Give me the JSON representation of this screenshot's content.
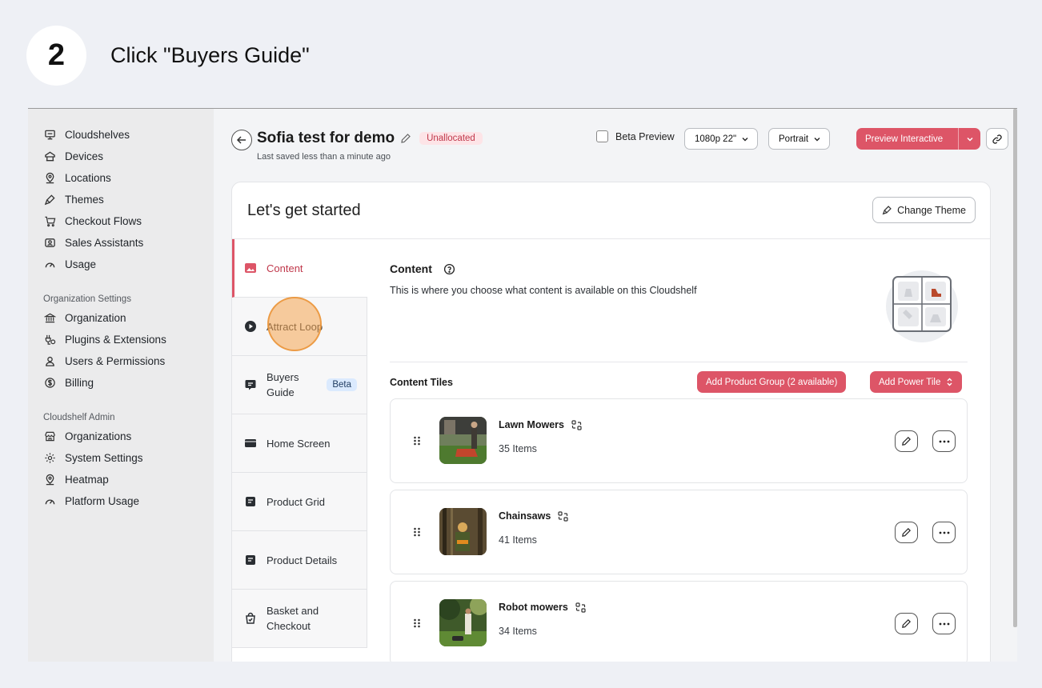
{
  "step": {
    "number": "2",
    "instruction": "Click \"Buyers Guide\""
  },
  "sidebar": {
    "items": [
      {
        "label": "Cloudshelves",
        "icon": "monitor-icon"
      },
      {
        "label": "Devices",
        "icon": "device-icon"
      },
      {
        "label": "Locations",
        "icon": "location-pin-icon"
      },
      {
        "label": "Themes",
        "icon": "brush-icon"
      },
      {
        "label": "Checkout Flows",
        "icon": "cart-icon"
      },
      {
        "label": "Sales Assistants",
        "icon": "id-card-icon"
      },
      {
        "label": "Usage",
        "icon": "gauge-icon"
      }
    ],
    "org_settings_label": "Organization Settings",
    "org_items": [
      {
        "label": "Organization",
        "icon": "bank-icon"
      },
      {
        "label": "Plugins & Extensions",
        "icon": "plugin-icon"
      },
      {
        "label": "Users & Permissions",
        "icon": "user-icon"
      },
      {
        "label": "Billing",
        "icon": "dollar-icon"
      }
    ],
    "admin_label": "Cloudshelf Admin",
    "admin_items": [
      {
        "label": "Organizations",
        "icon": "store-icon"
      },
      {
        "label": "System Settings",
        "icon": "gear-icon"
      },
      {
        "label": "Heatmap",
        "icon": "location-pin-icon"
      },
      {
        "label": "Platform Usage",
        "icon": "gauge-icon"
      }
    ]
  },
  "topbar": {
    "title": "Sofia test for demo",
    "status_badge": "Unallocated",
    "saved_text": "Last saved less than a minute ago",
    "beta_preview_label": "Beta Preview",
    "resolution": "1080p 22\"",
    "orientation": "Portrait",
    "preview_button": "Preview Interactive"
  },
  "card": {
    "title": "Let's get started",
    "change_theme": "Change Theme"
  },
  "tabs": [
    {
      "label": "Content"
    },
    {
      "label": "Attract Loop"
    },
    {
      "label": "Buyers Guide",
      "badge": "Beta"
    },
    {
      "label": "Home Screen"
    },
    {
      "label": "Product Grid"
    },
    {
      "label": "Product Details"
    },
    {
      "label": "Basket and Checkout"
    }
  ],
  "content": {
    "title": "Content",
    "description": "This is where you choose what content is available on this Cloudshelf",
    "tiles_label": "Content Tiles",
    "add_product_group": "Add Product Group (2 available)",
    "add_power_tile": "Add Power Tile",
    "tiles": [
      {
        "name": "Lawn Mowers",
        "count": "35 Items"
      },
      {
        "name": "Chainsaws",
        "count": "41 Items"
      },
      {
        "name": "Robot mowers",
        "count": "34 Items"
      }
    ]
  },
  "colors": {
    "accent": "#dd5567",
    "badge_bg": "#fde4e7",
    "beta_bg": "#dbeafe"
  }
}
